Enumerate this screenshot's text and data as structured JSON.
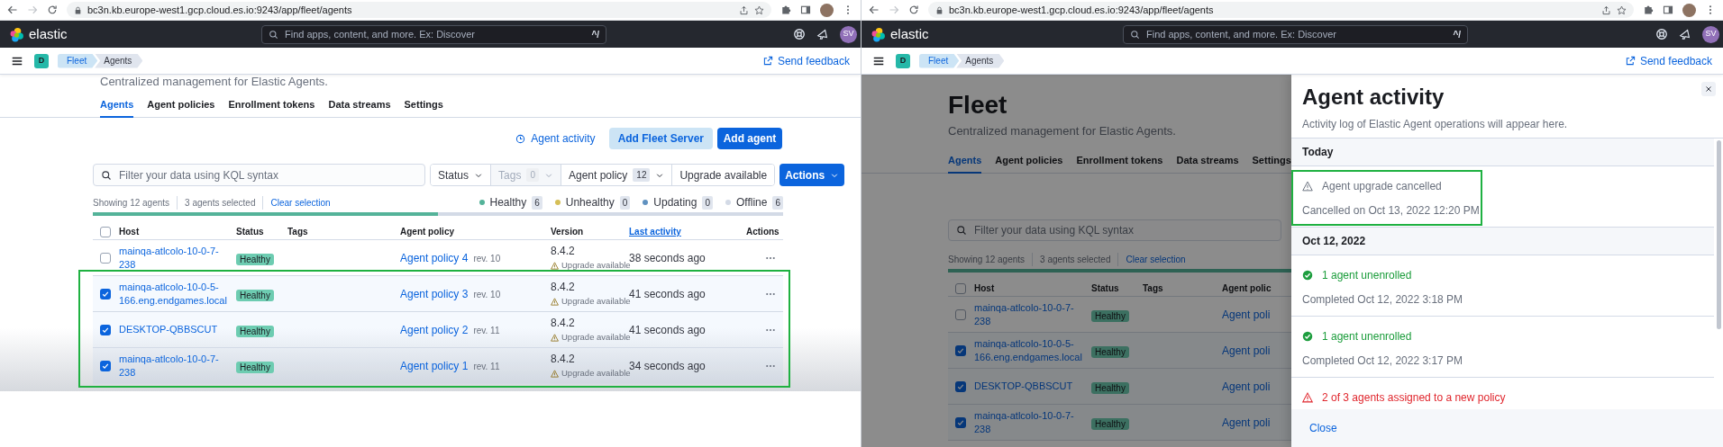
{
  "windows": [
    {
      "browser": {
        "url": "bc3n.kb.europe-west1.gcp.cloud.es.io:9243/app/fleet/agents"
      },
      "header": {
        "brand": "elastic",
        "search_placeholder": "Find apps, content, and more. Ex: Discover",
        "shortcut": "^/",
        "avatar": "SV"
      },
      "nav": {
        "space": "D",
        "breadcrumbs": [
          {
            "label": "Fleet",
            "selected": false
          },
          {
            "label": "Agents",
            "selected": true
          }
        ],
        "feedback": "Send feedback"
      },
      "page": {
        "subtitle": "Centralized management for Elastic Agents.",
        "tabs": [
          {
            "label": "Agents",
            "selected": true
          },
          {
            "label": "Agent policies",
            "selected": false
          },
          {
            "label": "Enrollment tokens",
            "selected": false
          },
          {
            "label": "Data streams",
            "selected": false
          },
          {
            "label": "Settings",
            "selected": false
          }
        ],
        "toolbar": {
          "activity": "Agent activity",
          "add_fleet_server": "Add Fleet Server",
          "add_agent": "Add agent"
        },
        "filters": {
          "search_placeholder": "Filter your data using KQL syntax",
          "menus": [
            {
              "kind": "dropdown",
              "label": "Status",
              "disabled": false
            },
            {
              "kind": "dropdown",
              "label": "Tags",
              "count": "0",
              "disabled": true
            },
            {
              "kind": "dropdown",
              "label": "Agent policy",
              "count": "12",
              "disabled": false
            },
            {
              "kind": "toggle",
              "label": "Upgrade available",
              "disabled": false
            }
          ],
          "actions": "Actions"
        },
        "summary": {
          "showing": "Showing 12 agents",
          "selected": "3 agents selected",
          "clear": "Clear selection",
          "statuses": [
            {
              "label": "Healthy",
              "count": "6",
              "color": "#54b399"
            },
            {
              "label": "Unhealthy",
              "count": "0",
              "color": "#d6bf57"
            },
            {
              "label": "Updating",
              "count": "0",
              "color": "#6092c0"
            },
            {
              "label": "Offline",
              "count": "6",
              "color": "#d3dae6"
            }
          ]
        },
        "health_bar": {
          "level": 0.5
        },
        "table": {
          "all_checked": false,
          "columns": [
            {
              "label": "Host",
              "sorted": false
            },
            {
              "label": "Status",
              "sorted": false
            },
            {
              "label": "Tags",
              "sorted": false
            },
            {
              "label": "Agent policy",
              "sorted": false
            },
            {
              "label": "Version",
              "sorted": false
            },
            {
              "label": "Last activity",
              "sorted": true
            },
            {
              "label": "Actions",
              "sorted": false
            }
          ],
          "rows": [
            {
              "checked": false,
              "host": "mainqa-atlcolo-10-0-7-238",
              "status": "Healthy",
              "policy": "Agent policy 4",
              "revision": "rev. 10",
              "version": "8.4.2",
              "notice": "Upgrade available",
              "last_activity": "38 seconds ago"
            },
            {
              "checked": true,
              "host": "mainqa-atlcolo-10-0-5-166.eng.endgames.local",
              "status": "Healthy",
              "policy": "Agent policy 3",
              "revision": "rev. 10",
              "version": "8.4.2",
              "notice": "Upgrade available",
              "last_activity": "41 seconds ago"
            },
            {
              "checked": true,
              "host": "DESKTOP-QBBSCUT",
              "status": "Healthy",
              "policy": "Agent policy 2",
              "revision": "rev. 11",
              "version": "8.4.2",
              "notice": "Upgrade available",
              "last_activity": "41 seconds ago"
            },
            {
              "checked": true,
              "host": "mainqa-atlcolo-10-0-7-238",
              "status": "Healthy",
              "policy": "Agent policy 1",
              "revision": "rev. 11",
              "version": "8.4.2",
              "notice": "Upgrade available",
              "last_activity": "34 seconds ago"
            }
          ]
        }
      }
    },
    {
      "browser": {
        "url": "bc3n.kb.europe-west1.gcp.cloud.es.io:9243/app/fleet/agents"
      },
      "header": {
        "brand": "elastic",
        "search_placeholder": "Find apps, content, and more. Ex: Discover",
        "shortcut": "^/",
        "avatar": "SV"
      },
      "nav": {
        "space": "D",
        "breadcrumbs": [
          {
            "label": "Fleet",
            "selected": false
          },
          {
            "label": "Agents",
            "selected": true
          }
        ],
        "feedback": "Send feedback"
      },
      "page": {
        "dimmed": true,
        "title": "Fleet",
        "subtitle": "Centralized management for Elastic Agents.",
        "tabs": [
          {
            "label": "Agents",
            "selected": true
          },
          {
            "label": "Agent policies",
            "selected": false
          },
          {
            "label": "Enrollment tokens",
            "selected": false
          },
          {
            "label": "Data streams",
            "selected": false
          },
          {
            "label": "Settings",
            "selected": false
          }
        ],
        "filters": {
          "search_placeholder": "Filter your data using KQL syntax"
        },
        "summary": {
          "showing": "Showing 12 agents",
          "selected": "3 agents selected",
          "clear": "Clear selection"
        },
        "health_bar": {
          "level": 0.5
        },
        "table": {
          "all_checked": false,
          "columns": [
            {
              "label": "Host",
              "sorted": false
            },
            {
              "label": "Status",
              "sorted": false
            },
            {
              "label": "Tags",
              "sorted": false
            },
            {
              "label": "Agent polic",
              "sorted": false
            }
          ],
          "rows": [
            {
              "checked": false,
              "host": "mainqa-atlcolo-10-0-7-238",
              "status": "Healthy",
              "policy": "Agent poli"
            },
            {
              "checked": true,
              "host": "mainqa-atlcolo-10-0-5-166.eng.endgames.local",
              "status": "Healthy",
              "policy": "Agent poli"
            },
            {
              "checked": true,
              "host": "DESKTOP-QBBSCUT",
              "status": "Healthy",
              "policy": "Agent poli"
            },
            {
              "checked": true,
              "host": "mainqa-atlcolo-10-0-7-238",
              "status": "Healthy",
              "policy": "Agent poli"
            }
          ]
        }
      },
      "flyout": {
        "title": "Agent activity",
        "description": "Activity log of Elastic Agent operations will appear here.",
        "groups": [
          {
            "label": "Today",
            "items": [
              {
                "kind": "warning",
                "title": "Agent upgrade cancelled",
                "detail": "Cancelled on Oct 13, 2022 12:20 PM"
              }
            ]
          },
          {
            "label": "Oct 12, 2022",
            "items": [
              {
                "kind": "success",
                "title": "1 agent unenrolled",
                "detail": "Completed Oct 12, 2022 3:18 PM"
              },
              {
                "kind": "success",
                "title": "1 agent unenrolled",
                "detail": "Completed Oct 12, 2022 3:17 PM"
              },
              {
                "kind": "error",
                "title": "2 of 3 agents assigned to a new policy"
              }
            ]
          }
        ],
        "close": "Close"
      }
    }
  ]
}
